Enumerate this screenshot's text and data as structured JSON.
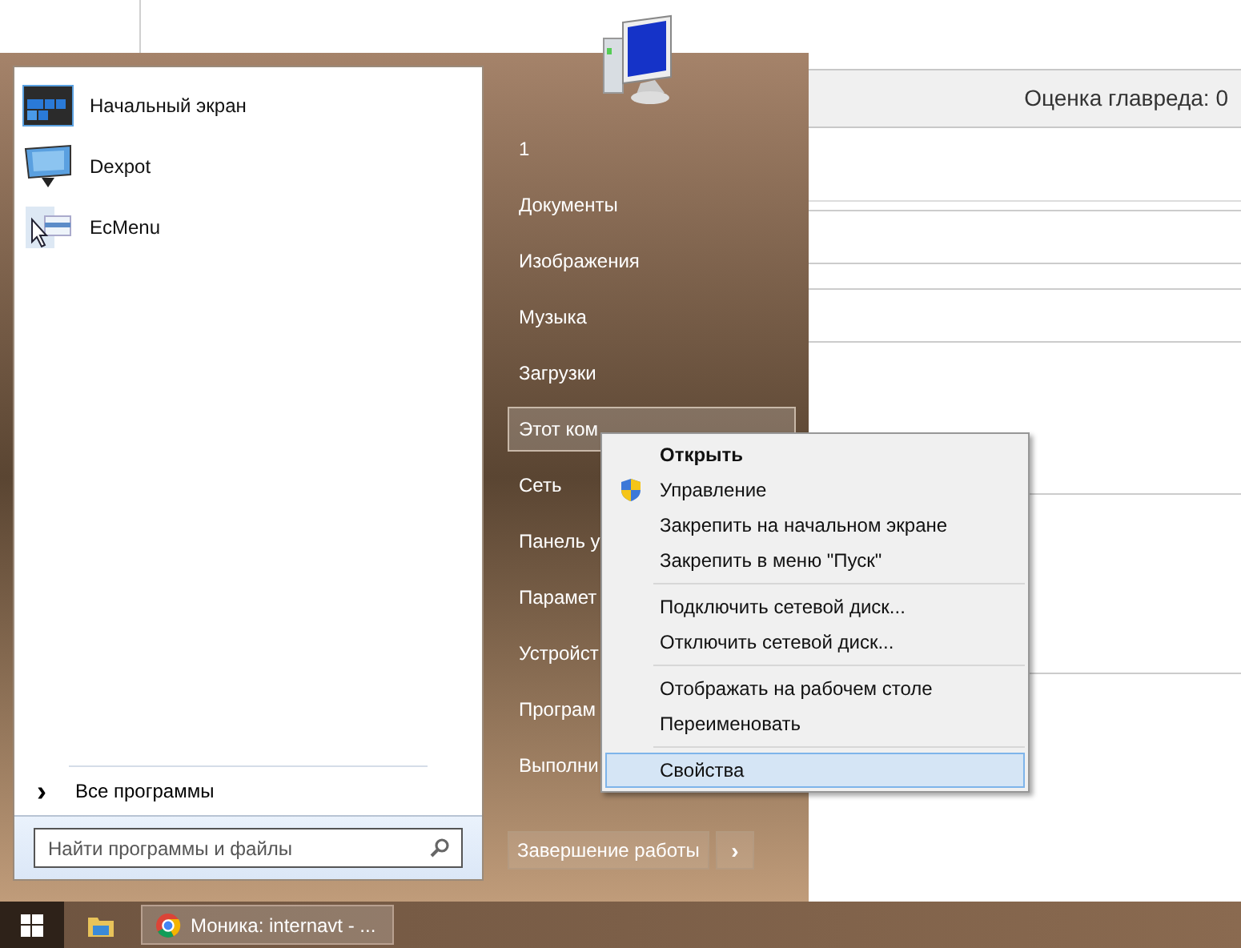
{
  "page": {
    "rating": "Оценка главреда: 0"
  },
  "start_menu": {
    "programs": [
      {
        "label": "Начальный экран",
        "kind": "tiles"
      },
      {
        "label": "Dexpot",
        "kind": "monitor"
      },
      {
        "label": "EcMenu",
        "kind": "cursor"
      }
    ],
    "all_programs": {
      "arrow": "›",
      "label": "Все программы"
    },
    "search": {
      "placeholder": "Найти программы и файлы"
    },
    "places": [
      {
        "label": "1",
        "selected": false
      },
      {
        "label": "Документы",
        "selected": false
      },
      {
        "label": "Изображения",
        "selected": false
      },
      {
        "label": "Музыка",
        "selected": false
      },
      {
        "label": "Загрузки",
        "selected": false
      },
      {
        "label": "Этот ком",
        "selected": true
      },
      {
        "label": "Сеть",
        "selected": false
      },
      {
        "label": "Панель у",
        "selected": false
      },
      {
        "label": "Парамет",
        "selected": false
      },
      {
        "label": "Устройст",
        "selected": false
      },
      {
        "label": "Програм",
        "selected": false
      },
      {
        "label": "Выполни",
        "selected": false
      }
    ],
    "shutdown": {
      "label": "Завершение работы",
      "arrow": "›"
    }
  },
  "context_menu": {
    "groups": [
      [
        {
          "label": "Открыть",
          "bold": true,
          "shield": false,
          "selected": false
        },
        {
          "label": "Управление",
          "bold": false,
          "shield": true,
          "selected": false
        },
        {
          "label": "Закрепить на начальном экране",
          "bold": false,
          "shield": false,
          "selected": false
        },
        {
          "label": "Закрепить в меню \"Пуск\"",
          "bold": false,
          "shield": false,
          "selected": false
        }
      ],
      [
        {
          "label": "Подключить сетевой диск...",
          "bold": false,
          "shield": false,
          "selected": false
        },
        {
          "label": "Отключить сетевой диск...",
          "bold": false,
          "shield": false,
          "selected": false
        }
      ],
      [
        {
          "label": "Отображать на рабочем столе",
          "bold": false,
          "shield": false,
          "selected": false
        },
        {
          "label": "Переименовать",
          "bold": false,
          "shield": false,
          "selected": false
        }
      ],
      [
        {
          "label": "Свойства",
          "bold": false,
          "shield": false,
          "selected": true
        }
      ]
    ]
  },
  "taskbar": {
    "tasks": [
      {
        "label": "Моника: internavt - ..."
      }
    ]
  }
}
